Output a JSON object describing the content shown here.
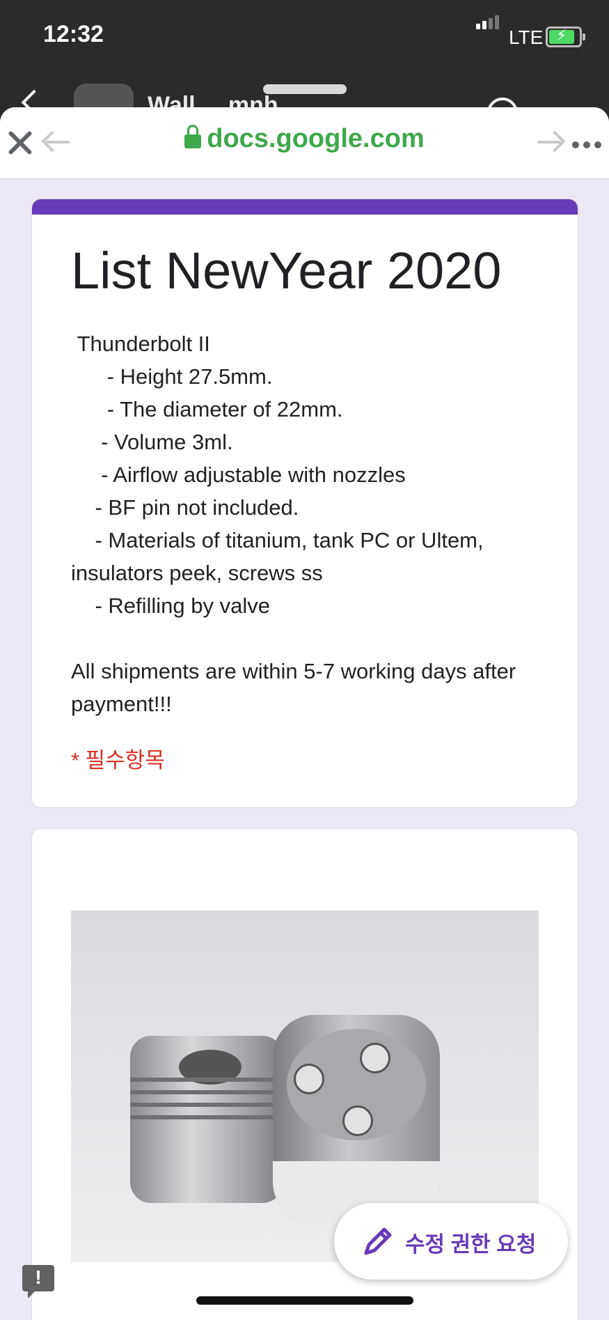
{
  "status_bar": {
    "time": "12:32",
    "network": "LTE"
  },
  "under_app": {
    "title": "Wall ... mnh"
  },
  "browser": {
    "url": "docs.google.com"
  },
  "form": {
    "title": "List NewYear 2020",
    "description": " Thunderbolt II\n      - Height 27.5mm.\n      - The diameter of 22mm.\n     - Volume 3ml.\n     - Airflow adjustable with nozzles\n    - BF pin not included.\n    - Materials of titanium, tank PC or Ultem, insulators peek, screws ss\n    - Refilling by valve\n\nAll shipments are within 5-7 working days after payment!!!",
    "required_label": "* 필수항목"
  },
  "fab": {
    "label": "수정 권한 요청"
  },
  "report": {
    "symbol": "!"
  },
  "colors": {
    "accent": "#673ab7",
    "url_green": "#3ea84a",
    "required_red": "#d93025",
    "background": "#ece8f6"
  }
}
